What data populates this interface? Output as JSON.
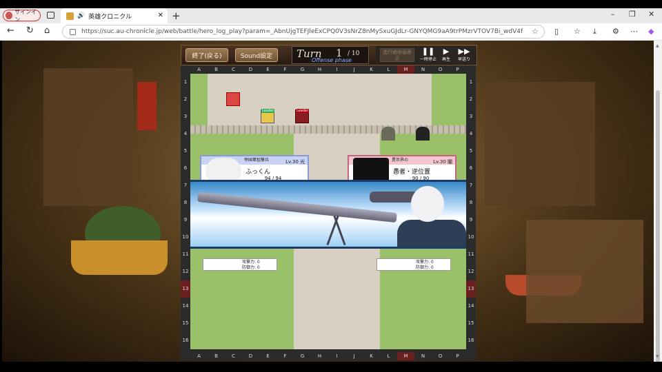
{
  "browser": {
    "signin_label": "サインイン",
    "tab_title": "英雄クロニクル",
    "new_tab_symbol": "+",
    "close_symbol": "✕",
    "url": "https://suc.au-chronicle.jp/web/battle/hero_log_play?param=_AbnUjgTEFJleExCPQ0V3sNrZ8nMySxuGJdLr-GNYQMG9aA9trPMzrVTOV7Bi_wdV4fA9LaGlBGBlZcHZp0...",
    "icons": [
      "person-icon",
      "tab-icon",
      "speaker-icon",
      "back-icon",
      "reload-icon",
      "home-icon",
      "lock-icon",
      "star-icon",
      "split-icon",
      "favorites-icon",
      "extension-icon",
      "more-icon",
      "copilot-icon"
    ]
  },
  "game": {
    "end_button": "終了(戻る)",
    "sound_button": "Sound設定",
    "turn_word": "Turn",
    "turn_current": "1",
    "turn_total": "/ 10",
    "phase": "Offense phase",
    "skip_button": "進行戦術画表示",
    "pause_label": "一時停止",
    "play_label": "再生",
    "fast_label": "早送り",
    "columns": [
      "A",
      "B",
      "C",
      "D",
      "E",
      "F",
      "G",
      "H",
      "I",
      "J",
      "K",
      "L",
      "M",
      "N",
      "O",
      "P"
    ],
    "rows": [
      "1",
      "2",
      "3",
      "4",
      "5",
      "6",
      "7",
      "8",
      "9",
      "10",
      "11",
      "12",
      "13",
      "14",
      "15",
      "16"
    ],
    "highlight_column": "M",
    "highlight_row": "13",
    "leader_tag": "Leader",
    "player_card": {
      "header": "帝国軍狙撃兵",
      "level": "Lv.30 光",
      "name": "ふっくん",
      "hp": "94 / 94",
      "stat1": "攻撃力: 0",
      "stat2": "防御力: 0"
    },
    "enemy_card": {
      "header": "異世界の",
      "level": "Lv.30 闇",
      "name": "愚者・逆位置",
      "hp": "90 / 90",
      "stat1": "攻撃力: 0",
      "stat2": "防御力: 0"
    },
    "colors": {
      "player_card_accent": "#8a9ad8",
      "enemy_card_accent": "#c8607a",
      "hp_bar": "#2a8a2a",
      "grass": "#9bc06a"
    }
  }
}
